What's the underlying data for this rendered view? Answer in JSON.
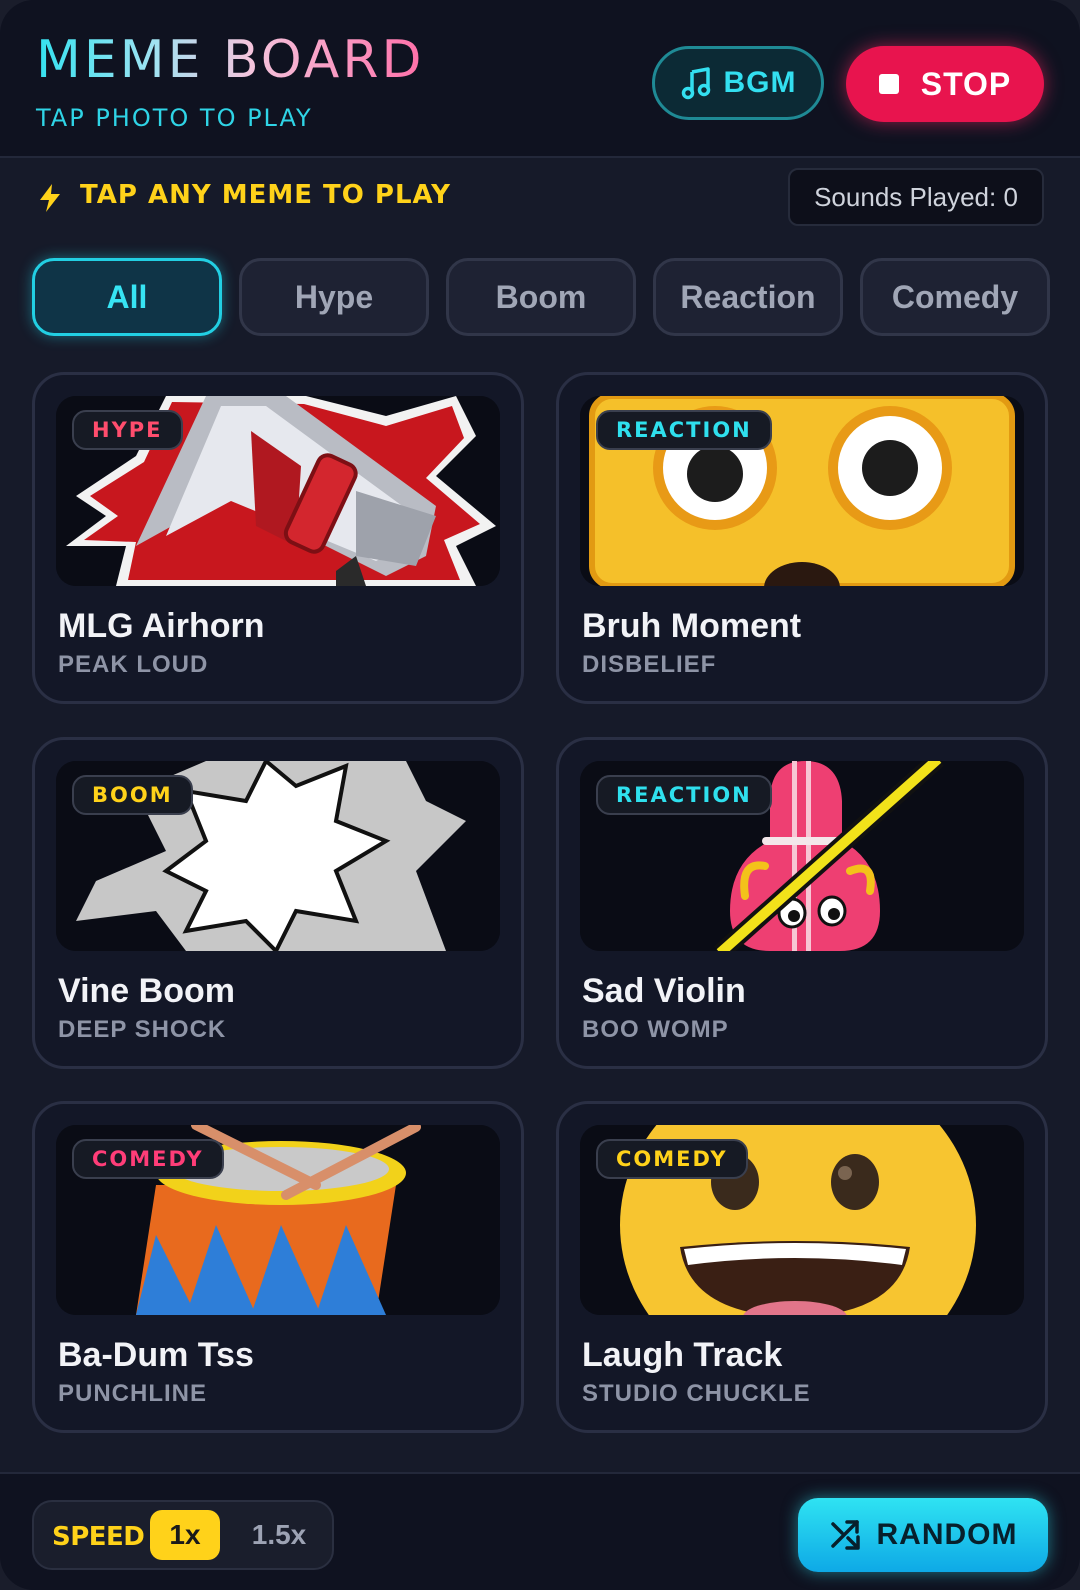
{
  "header": {
    "title": "MEME BOARD",
    "subtitle": "TAP PHOTO TO PLAY",
    "bgm_label": "BGM",
    "stop_label": "STOP"
  },
  "info": {
    "prompt": "TAP ANY MEME TO PLAY",
    "counter": "Sounds Played: 0"
  },
  "filters": {
    "selected": "All",
    "tabs": [
      "All",
      "Hype",
      "Boom",
      "Reaction",
      "Comedy"
    ]
  },
  "cards": [
    {
      "badge": "HYPE",
      "title": "MLG Airhorn",
      "subtitle": "PEAK LOUD",
      "icon": "airhorn-image"
    },
    {
      "badge": "REACTION",
      "title": "Bruh Moment",
      "subtitle": "DISBELIEF",
      "icon": "shocked-face-image"
    },
    {
      "badge": "BOOM",
      "title": "Vine Boom",
      "subtitle": "DEEP SHOCK",
      "icon": "boom-burst-image"
    },
    {
      "badge": "REACTION",
      "title": "Sad Violin",
      "subtitle": "BOO WOMP",
      "icon": "sad-violin-image"
    },
    {
      "badge": "COMEDY",
      "title": "Ba-Dum Tss",
      "subtitle": "PUNCHLINE",
      "icon": "drum-image"
    },
    {
      "badge": "COMEDY",
      "title": "Laugh Track",
      "subtitle": "STUDIO CHUCKLE",
      "icon": "laughing-face-image"
    }
  ],
  "footer": {
    "speed_label": "SPEED",
    "speed_options": [
      "1x",
      "1.5x"
    ],
    "speed_selected": "1x",
    "random_label": "RANDOM"
  },
  "colors": {
    "accent_cyan": "#2fe0ee",
    "stop_red": "#e8144e",
    "highlight_yellow": "#ffd21a",
    "background": "#161a29"
  }
}
